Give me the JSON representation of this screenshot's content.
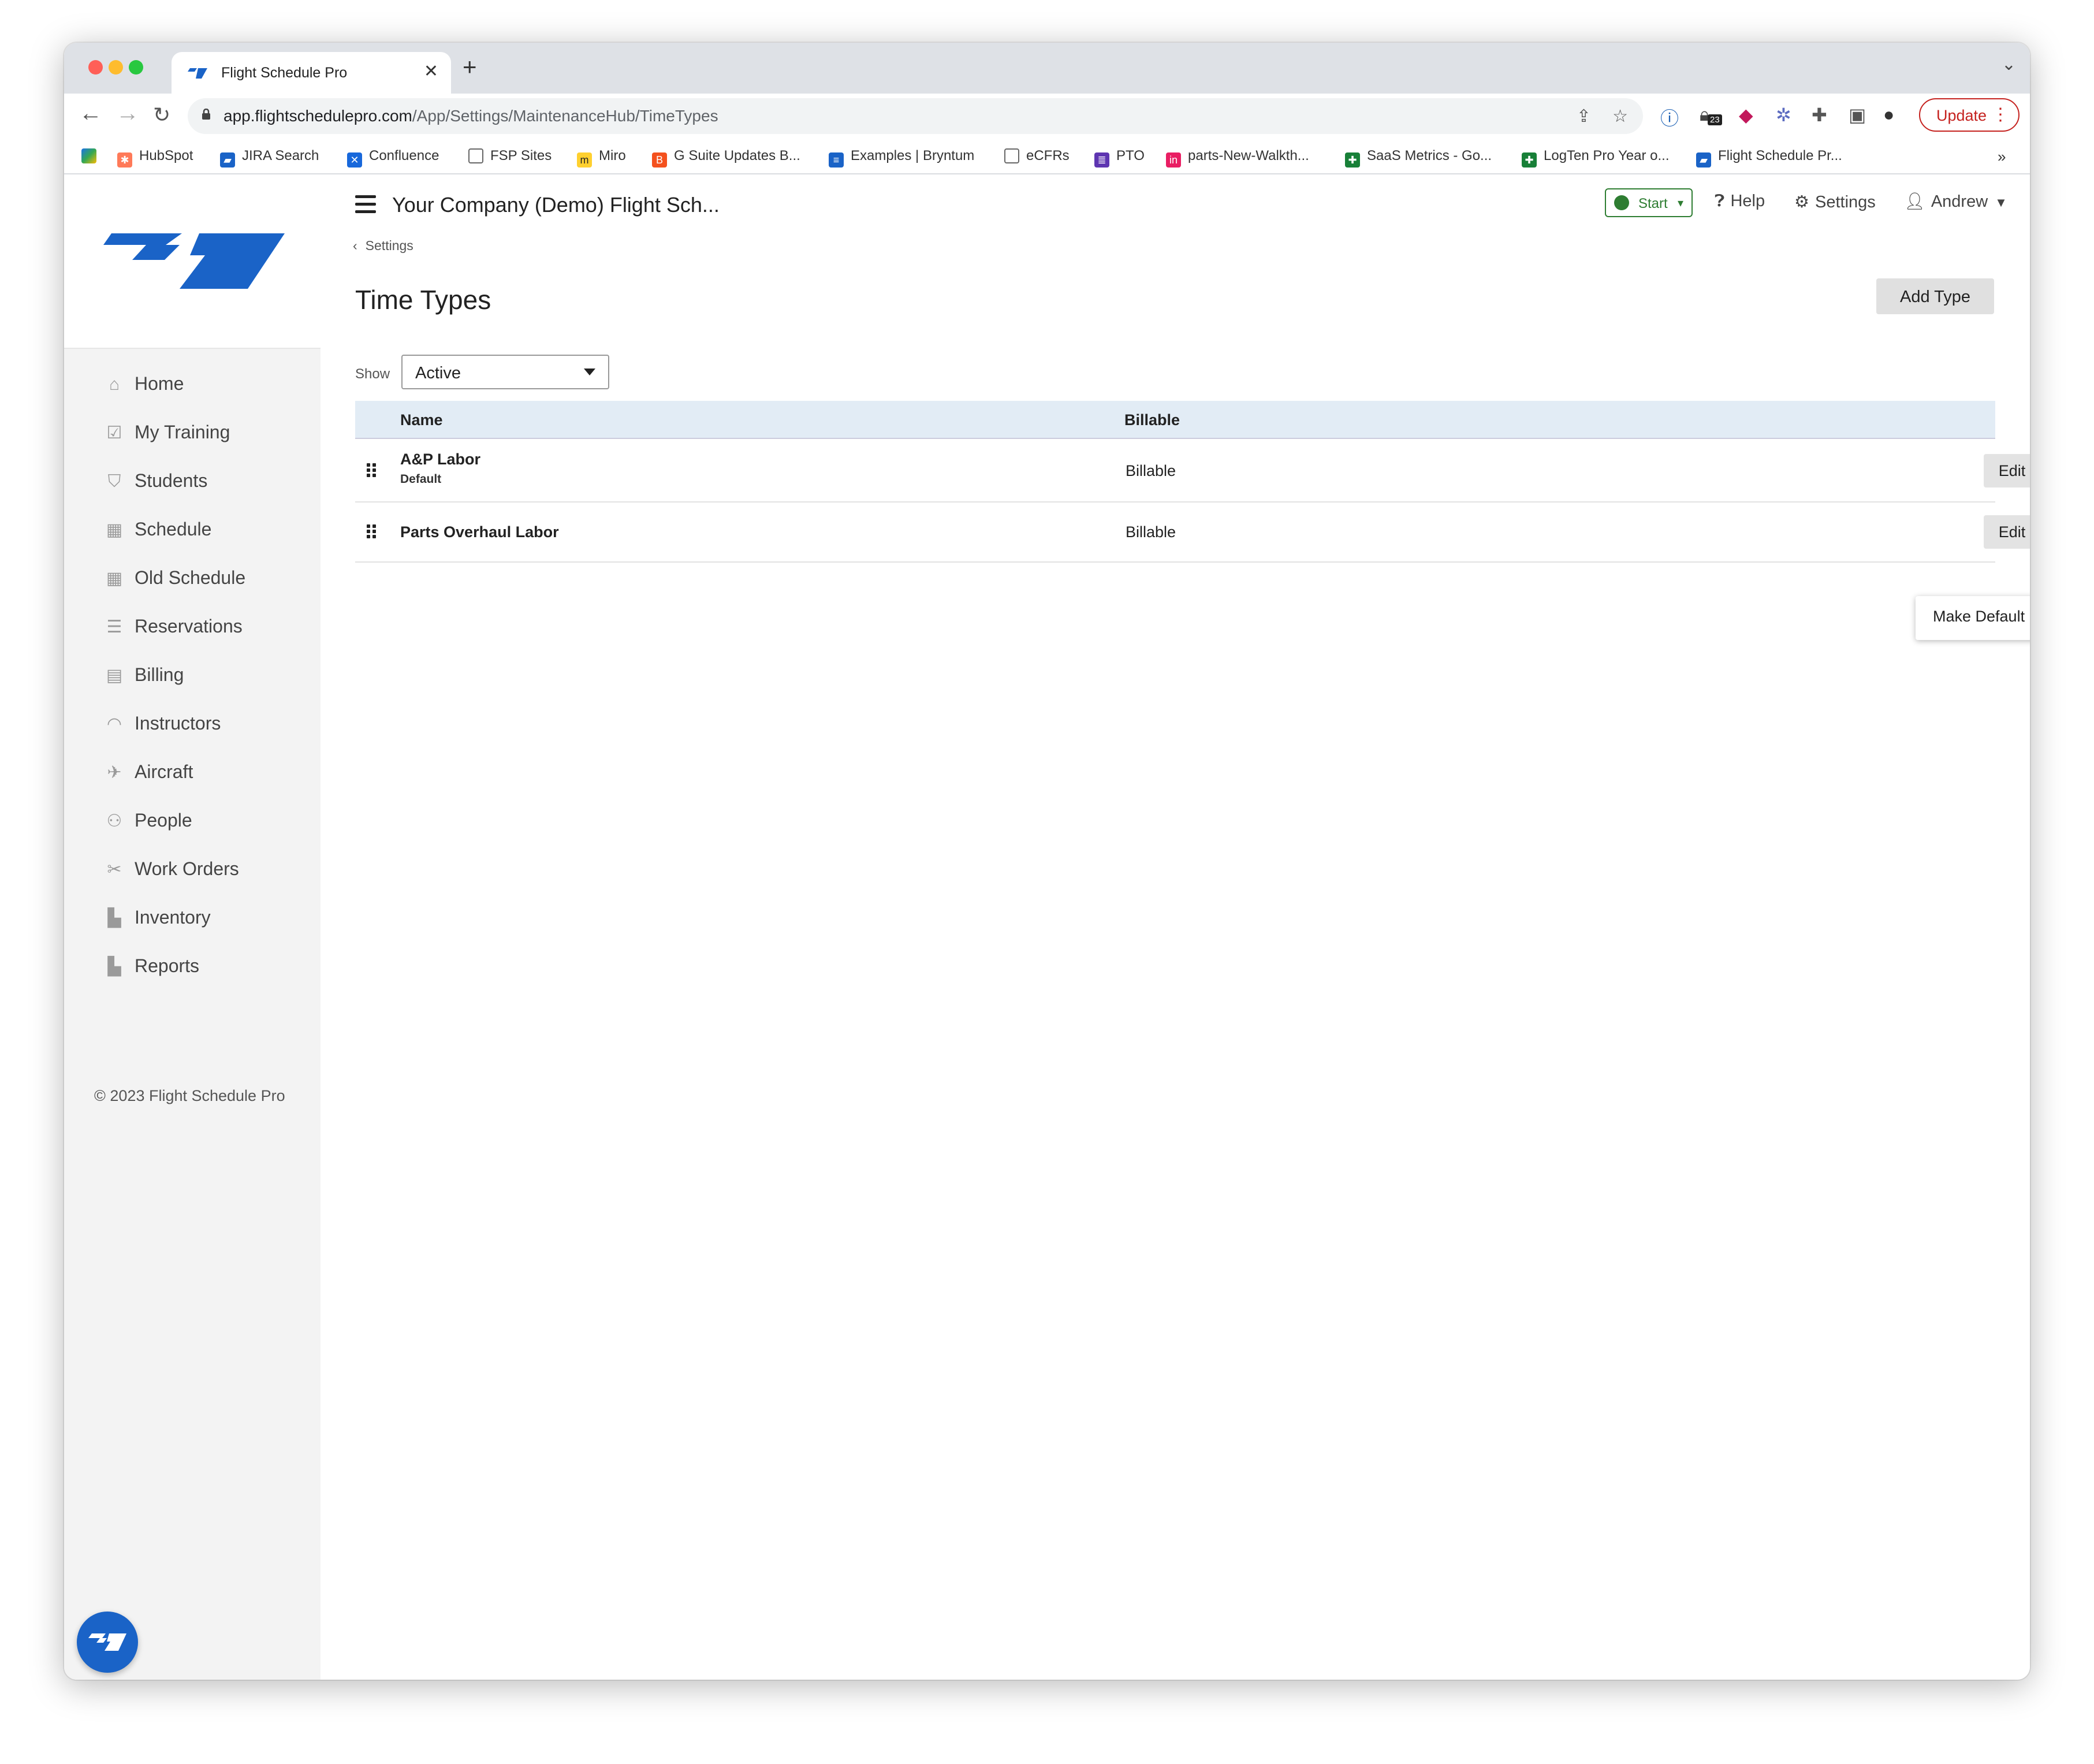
{
  "browser": {
    "tab_title": "Flight Schedule Pro",
    "url_host": "app.flightschedulepro.com",
    "url_path": "/App/Settings/MaintenanceHub/TimeTypes",
    "update_label": "Update",
    "extension_badge": "23",
    "bookmarks": [
      "HubSpot",
      "JIRA Search",
      "Confluence",
      "FSP Sites",
      "Miro",
      "G Suite Updates B...",
      "Examples | Bryntum",
      "eCFRs",
      "PTO",
      "parts-New-Walkth...",
      "SaaS Metrics - Go...",
      "LogTen Pro Year o...",
      "Flight Schedule Pr..."
    ],
    "bookmark_overflow": "»"
  },
  "sidebar": {
    "items": [
      {
        "label": "Home",
        "icon": "home-icon"
      },
      {
        "label": "My Training",
        "icon": "checkbox-icon"
      },
      {
        "label": "Students",
        "icon": "graduation-cap-icon"
      },
      {
        "label": "Schedule",
        "icon": "calendar-icon"
      },
      {
        "label": "Old Schedule",
        "icon": "calendar-icon"
      },
      {
        "label": "Reservations",
        "icon": "list-icon"
      },
      {
        "label": "Billing",
        "icon": "credit-card-icon"
      },
      {
        "label": "Instructors",
        "icon": "headset-icon"
      },
      {
        "label": "Aircraft",
        "icon": "airplane-icon"
      },
      {
        "label": "People",
        "icon": "people-icon"
      },
      {
        "label": "Work Orders",
        "icon": "tools-icon"
      },
      {
        "label": "Inventory",
        "icon": "boxes-icon"
      },
      {
        "label": "Reports",
        "icon": "bar-chart-icon"
      }
    ],
    "copyright": "© 2023 Flight Schedule Pro"
  },
  "header": {
    "company": "Your Company (Demo) Flight Sch...",
    "start_label": "Start",
    "help_label": "Help",
    "settings_label": "Settings",
    "user_label": "Andrew"
  },
  "page": {
    "breadcrumb": "Settings",
    "title": "Time Types",
    "add_button": "Add Type",
    "show_label": "Show",
    "show_value": "Active",
    "columns": {
      "name": "Name",
      "billable": "Billable"
    },
    "rows": [
      {
        "name": "A&P Labor",
        "sub": "Default",
        "billable": "Billable",
        "edit": "Edit"
      },
      {
        "name": "Parts Overhaul Labor",
        "sub": "",
        "billable": "Billable",
        "edit": "Edit"
      }
    ],
    "dropdown_item": "Make Default"
  },
  "colors": {
    "brand": "#1a63c7",
    "start_green": "#2e7d32",
    "table_header_bg": "#e2ecf5",
    "update_red": "#c5221f"
  }
}
